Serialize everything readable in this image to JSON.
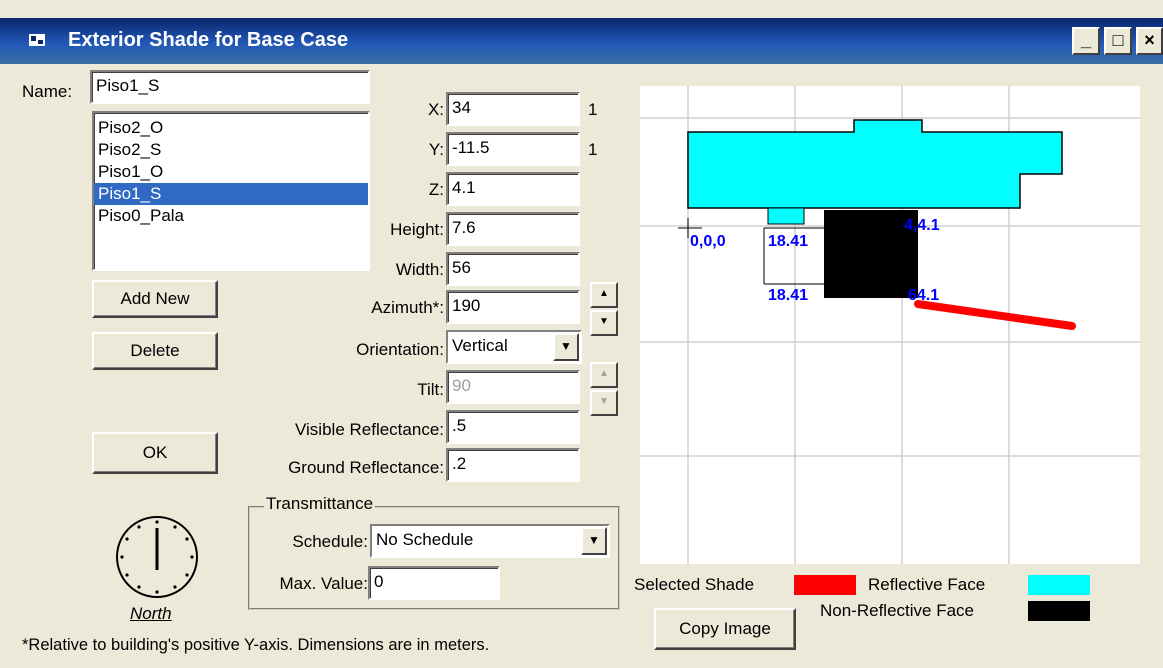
{
  "window": {
    "title": "Exterior Shade for Base Case",
    "buttons": [
      "_",
      "□",
      "×"
    ]
  },
  "name": {
    "label": "Name:",
    "value": "Piso1_S"
  },
  "shade_list": {
    "items": [
      "Piso2_O",
      "Piso2_S",
      "Piso1_O",
      "Piso1_S",
      "Piso0_Pala"
    ],
    "selected": "Piso1_S"
  },
  "buttons": {
    "add_new": "Add New",
    "delete": "Delete",
    "ok": "OK",
    "copy_image": "Copy Image"
  },
  "fields": {
    "x": {
      "label": "X:",
      "value": "34",
      "suffix": "1"
    },
    "y": {
      "label": "Y:",
      "value": "-11.5",
      "suffix": "1"
    },
    "z": {
      "label": "Z:",
      "value": "4.1"
    },
    "height": {
      "label": "Height:",
      "value": "7.6"
    },
    "width": {
      "label": "Width:",
      "value": "56"
    },
    "azimuth": {
      "label": "Azimuth*:",
      "value": "190"
    },
    "orientation": {
      "label": "Orientation:",
      "value": "Vertical"
    },
    "tilt": {
      "label": "Tilt:",
      "value": "90"
    },
    "visible_reflectance": {
      "label": "Visible Reflectance:",
      "value": ".5"
    },
    "ground_reflectance": {
      "label": "Ground Reflectance:",
      "value": ".2"
    }
  },
  "transmittance": {
    "title": "Transmittance",
    "schedule_label": "Schedule:",
    "schedule_value": "No Schedule",
    "max_label": "Max. Value:",
    "max_value": "0"
  },
  "compass": {
    "label": "North"
  },
  "footnote": "*Relative to building's positive Y-axis.   Dimensions are in meters.",
  "plot": {
    "origin_label": "0,0,0",
    "label_1": "18.41",
    "label_2": "18.41",
    "label_3": "4,4.1",
    "label_4": "64.1"
  },
  "legend": {
    "selected_shade": {
      "label": "Selected Shade",
      "color": "#ff0000"
    },
    "reflective_face": {
      "label": "Reflective Face",
      "color": "#00ffff"
    },
    "non_reflective_face": {
      "label": "Non-Reflective Face",
      "color": "#000000"
    }
  }
}
